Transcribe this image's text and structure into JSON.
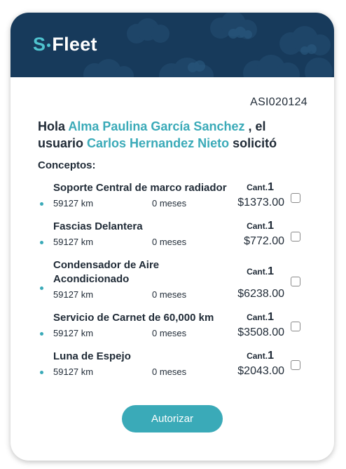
{
  "brand": {
    "logo_s": "S",
    "logo_rest": "Fleet"
  },
  "request": {
    "code": "ASI020124"
  },
  "greeting": {
    "hello": "Hola",
    "recipient": "Alma Paulina García Sanchez",
    "mid": ", el usuario",
    "requester": "Carlos Hernandez Nieto",
    "end": "solicitó"
  },
  "concepts": {
    "label": "Conceptos:",
    "qty_label": "Cant.",
    "items": [
      {
        "name": "Soporte Central de marco radiador",
        "km": "59127 km",
        "months": "0 meses",
        "qty": "1",
        "price": "$1373.00"
      },
      {
        "name": "Fascias Delantera",
        "km": "59127 km",
        "months": "0 meses",
        "qty": "1",
        "price": "$772.00"
      },
      {
        "name": "Condensador de Aire Acondicionado",
        "km": "59127 km",
        "months": "0 meses",
        "qty": "1",
        "price": "$6238.00"
      },
      {
        "name": "Servicio de Carnet de 60,000 km",
        "km": "59127 km",
        "months": "0 meses",
        "qty": "1",
        "price": "$3508.00"
      },
      {
        "name": "Luna de Espejo",
        "km": "59127 km",
        "months": "0 meses",
        "qty": "1",
        "price": "$2043.00"
      }
    ]
  },
  "actions": {
    "authorize_label": "Autorizar"
  },
  "colors": {
    "header": "#173a5b",
    "accent": "#3aaab8",
    "text": "#1f2a36"
  }
}
